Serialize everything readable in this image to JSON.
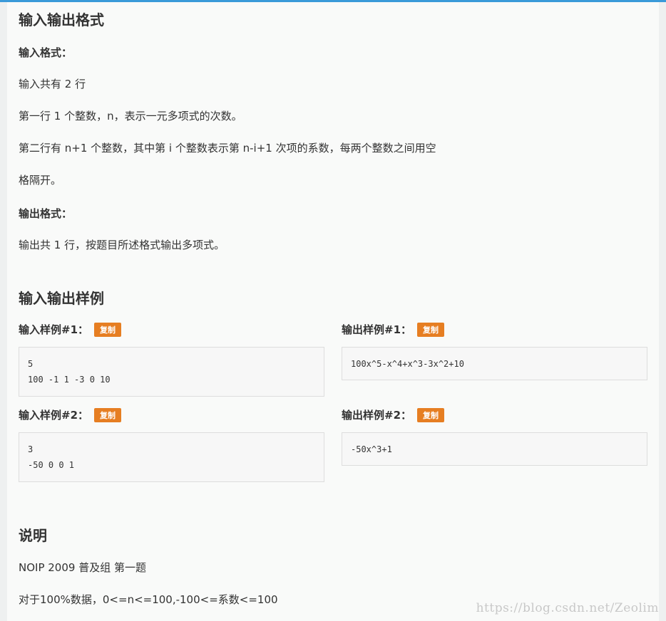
{
  "io_format": {
    "heading": "输入输出格式",
    "input_label": "输入格式：",
    "input_lines": [
      "输入共有 2 行",
      "第一行 1 个整数，n，表示一元多项式的次数。",
      "第二行有 n+1 个整数，其中第 i 个整数表示第 n-i+1 次项的系数，每两个整数之间用空",
      "格隔开。"
    ],
    "output_label": "输出格式：",
    "output_lines": [
      "输出共 1 行，按题目所述格式输出多项式。"
    ]
  },
  "samples": {
    "heading": "输入输出样例",
    "copy_label": "复制",
    "items": [
      {
        "input_label": "输入样例#1：",
        "input": "5\n100 -1 1 -3 0 10",
        "output_label": "输出样例#1：",
        "output": "100x^5-x^4+x^3-3x^2+10"
      },
      {
        "input_label": "输入样例#2：",
        "input": "3\n-50 0 0 1",
        "output_label": "输出样例#2：",
        "output": "-50x^3+1"
      }
    ]
  },
  "notes": {
    "heading": "说明",
    "lines": [
      "NOIP 2009 普及组 第一题",
      "对于100%数据，0<=n<=100,-100<=系数<=100"
    ]
  },
  "watermark": "https://blog.csdn.net/Zeolim",
  "colors": {
    "accent": "#3a9ad9",
    "copy_button": "#e67e22"
  }
}
